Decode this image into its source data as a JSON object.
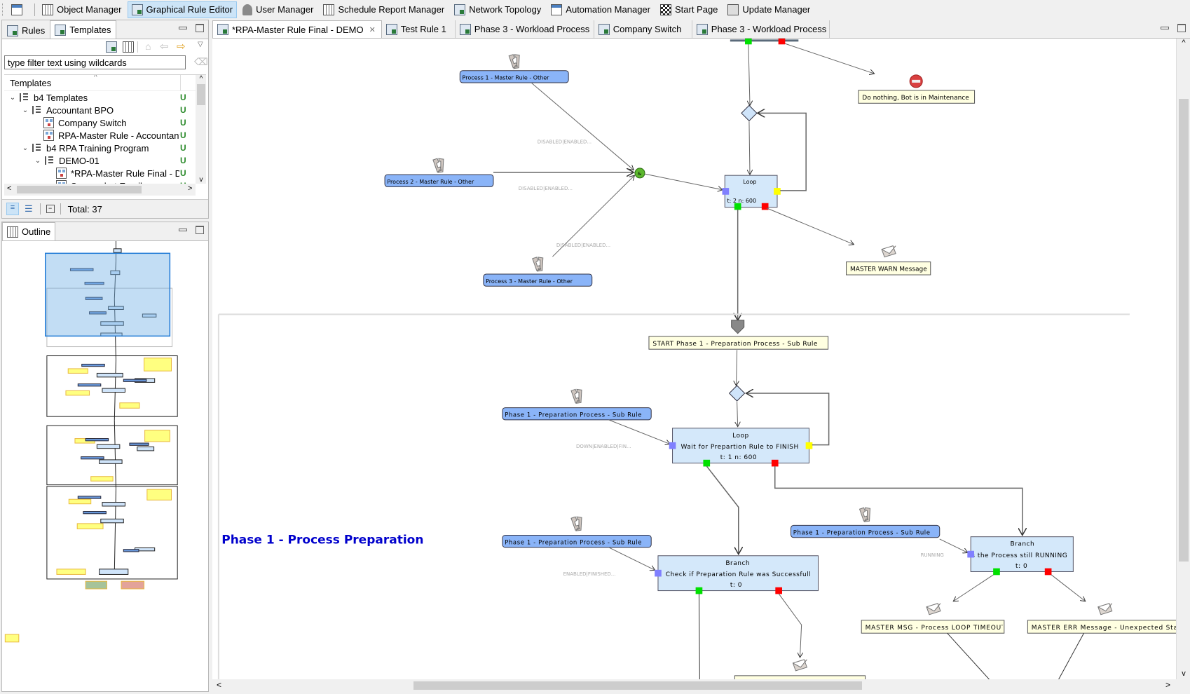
{
  "toolbar": {
    "items": [
      {
        "label": "Object Manager",
        "icon": "object-manager-icon"
      },
      {
        "label": "Graphical Rule Editor",
        "icon": "rule-editor-icon",
        "active": true
      },
      {
        "label": "User Manager",
        "icon": "users-icon"
      },
      {
        "label": "Schedule Report Manager",
        "icon": "schedule-icon"
      },
      {
        "label": "Network Topology",
        "icon": "network-icon"
      },
      {
        "label": "Automation Manager",
        "icon": "automation-icon"
      },
      {
        "label": "Start Page",
        "icon": "flag-icon"
      },
      {
        "label": "Update Manager",
        "icon": "update-icon"
      }
    ]
  },
  "left_panel": {
    "tabs": [
      {
        "label": "Rules"
      },
      {
        "label": "Templates",
        "selected": true
      }
    ],
    "filter": {
      "placeholder": "type filter text using wildcards",
      "value": "type filter text using wildcards"
    },
    "tree_header": "Templates",
    "tree": [
      {
        "label": "b4 Templates",
        "level": 0,
        "expanded": true,
        "type": "folder",
        "status": "U"
      },
      {
        "label": "Accountant BPO",
        "level": 1,
        "expanded": true,
        "type": "folder",
        "status": "U"
      },
      {
        "label": "Company Switch",
        "level": 2,
        "type": "rule",
        "status": "U"
      },
      {
        "label": "RPA-Master Rule - Accountant BPO",
        "level": 2,
        "type": "rule",
        "status": "U"
      },
      {
        "label": "b4 RPA Training Program",
        "level": 1,
        "expanded": true,
        "type": "folder",
        "status": "U"
      },
      {
        "label": "DEMO-01",
        "level": 2,
        "expanded": true,
        "type": "folder",
        "status": "U"
      },
      {
        "label": "*RPA-Master Rule Final - DEMO",
        "level": 3,
        "type": "rule",
        "status": "U"
      },
      {
        "label": "Screenshot Email",
        "level": 3,
        "type": "rule",
        "collapsed": true,
        "status": "U"
      }
    ],
    "total": "Total: 37"
  },
  "outline": {
    "title": "Outline"
  },
  "editor": {
    "tabs": [
      {
        "label": "*RPA-Master Rule Final - DEMO",
        "selected": true,
        "closable": true
      },
      {
        "label": "Test Rule 1"
      },
      {
        "label": "Phase 3 - Workload Process"
      },
      {
        "label": "Company Switch"
      },
      {
        "label": "Phase 3 - Workload Process"
      }
    ]
  },
  "diagram": {
    "nodes": {
      "p1": "Process 1 - Master Rule - Other",
      "p2": "Process 2 - Master Rule - Other",
      "p3": "Process 3 - Master Rule - Other",
      "maint": "Do nothing, Bot is in Maintenance",
      "loop1_title": "Loop",
      "loop1_info": "t: 2 n: 600",
      "warn": "MASTER WARN Message",
      "and": "&",
      "start": "START Phase 1 - Preparation Process - Sub Rule",
      "sub1": "Phase 1 - Preparation Process - Sub Rule",
      "loop2_title": "Loop",
      "loop2_desc": "Wait for Prepartion Rule to FINISH",
      "loop2_info": "t: 1 n: 600",
      "sub2": "Phase 1 - Preparation Process - Sub Rule",
      "branch1_title": "Branch",
      "branch1_desc": "Check if Preparation Rule was Successfull",
      "branch1_info": "t: 0",
      "sub3": "Phase 1 - Preparation Process - Sub Rule",
      "branch2_title": "Branch",
      "branch2_desc": "Is the Process still RUNNING",
      "branch2_info": "t: 0",
      "msg": "MASTER MSG - Process LOOP TIMEOUT",
      "err": "MASTER ERR Message - Unexpected State"
    },
    "edge_labels": {
      "e1": "DISABLED|ENABLED...",
      "e2": "DISABLED|ENABLED...",
      "e3": "DISABLED|ENABLED...",
      "e4": "DOWN|ENABLED|FIN...",
      "e5": "ENABLED|FINISHED...",
      "e6": "RUNNING"
    },
    "phase_label": "Phase 1 - Process Preparation",
    "colors": {
      "rule_node": "#8ab4f8",
      "logic_node": "#d4e8fa",
      "message_node": "#ffffe1",
      "port_in": "#8080ff",
      "port_ok": "#00e000",
      "port_err": "#ff0000",
      "port_loop": "#ffff00",
      "phase_text": "#0000cc"
    }
  }
}
